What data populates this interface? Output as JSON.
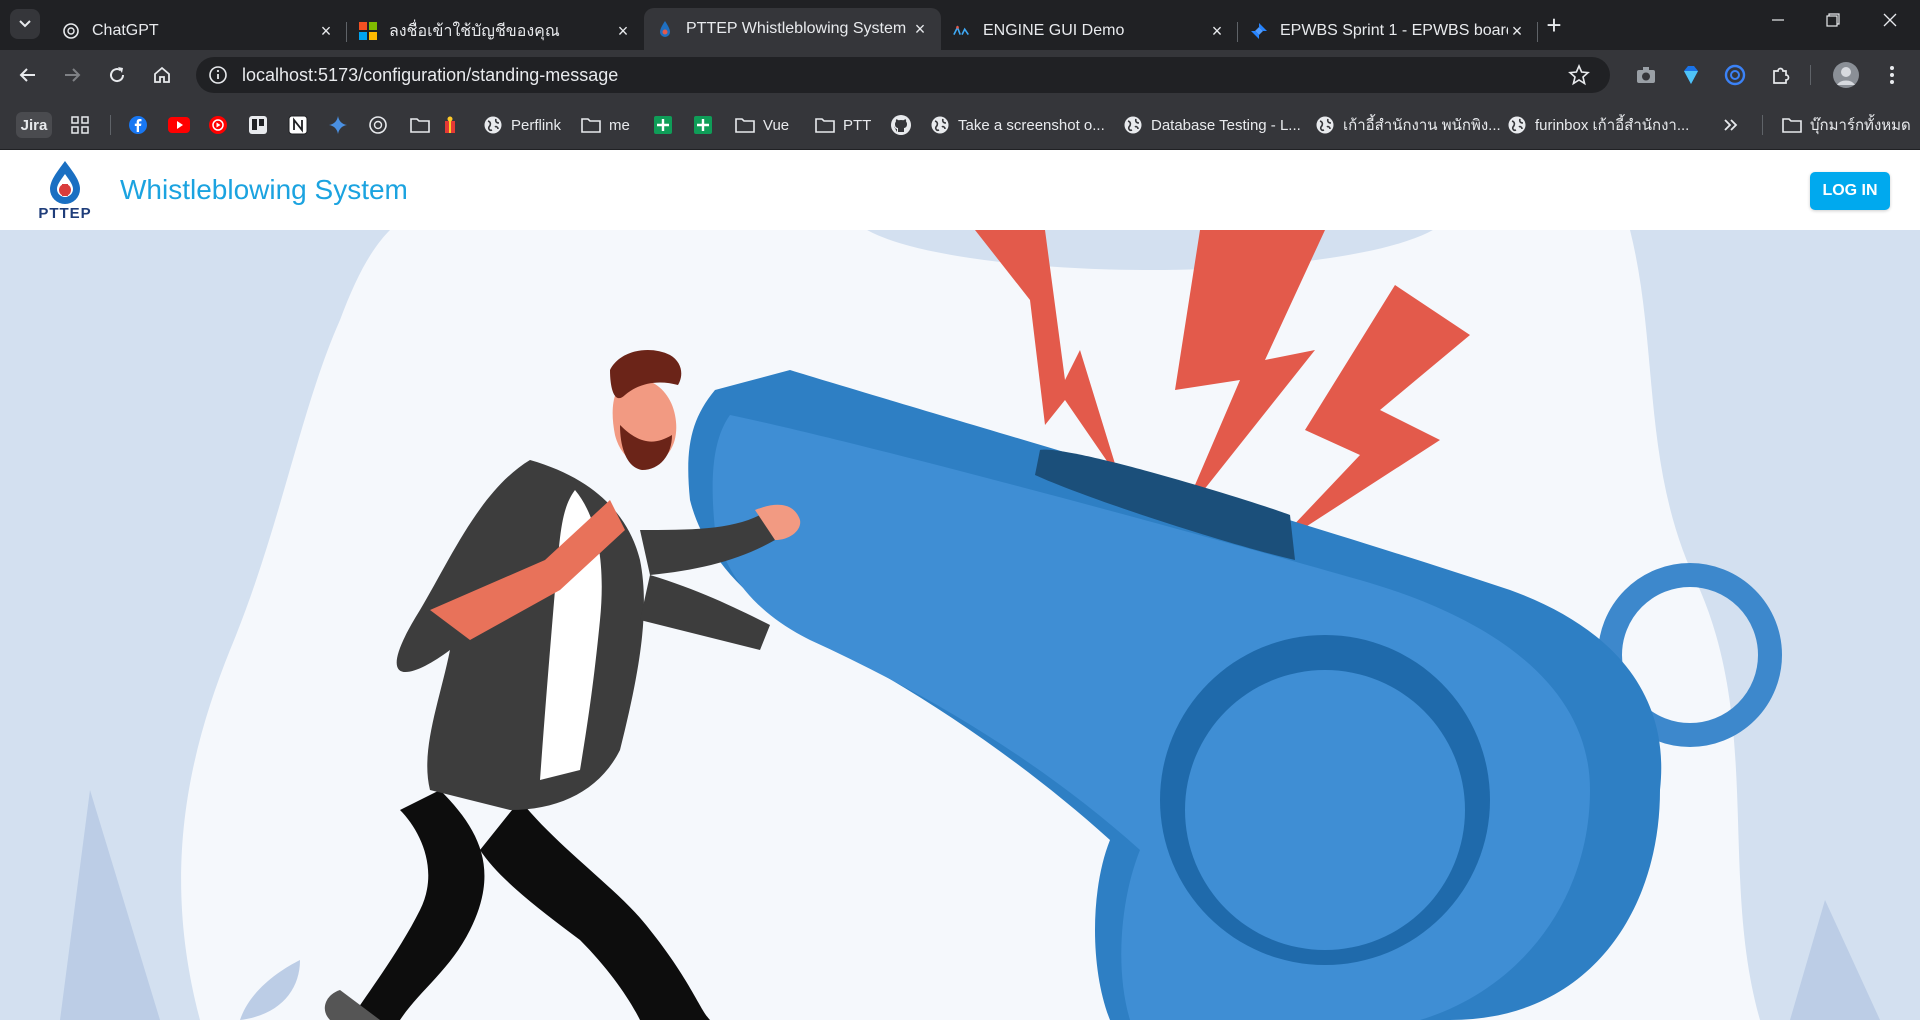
{
  "browser": {
    "tabs": [
      {
        "title": "ChatGPT",
        "icon": "chatgpt-icon",
        "active": false
      },
      {
        "title": "ลงชื่อเข้าใช้บัญชีของคุณ",
        "icon": "microsoft-icon",
        "active": false
      },
      {
        "title": "PTTEP Whistleblowing System",
        "icon": "pttep-icon",
        "active": true
      },
      {
        "title": "ENGINE GUI Demo",
        "icon": "engine-icon",
        "active": false
      },
      {
        "title": "EPWBS Sprint 1 - EPWBS board",
        "icon": "jira-icon",
        "active": false
      }
    ],
    "url": "localhost:5173/configuration/standing-message",
    "bookmarks": {
      "jira": "Jira",
      "perflink": "Perflink",
      "me": "me",
      "vue": "Vue",
      "ptt": "PTT",
      "screenshot": "Take a screenshot o...",
      "dbtesting": "Database Testing - L...",
      "office_chair": "เก้าอี้สำนักงาน พนักพิง...",
      "furinbox": "furinbox เก้าอี้สำนักงา...",
      "all_bookmarks": "บุ๊กมาร์กทั้งหมด"
    }
  },
  "app": {
    "logo_text": "PTTEP",
    "title": "Whistleblowing System",
    "login_label": "LOG IN"
  },
  "colors": {
    "accent": "#1ba3e0",
    "button": "#00a9ee",
    "whistle": "#2e7fc4",
    "bolt": "#e35a4b",
    "hero_bg": "#cfdcef"
  }
}
